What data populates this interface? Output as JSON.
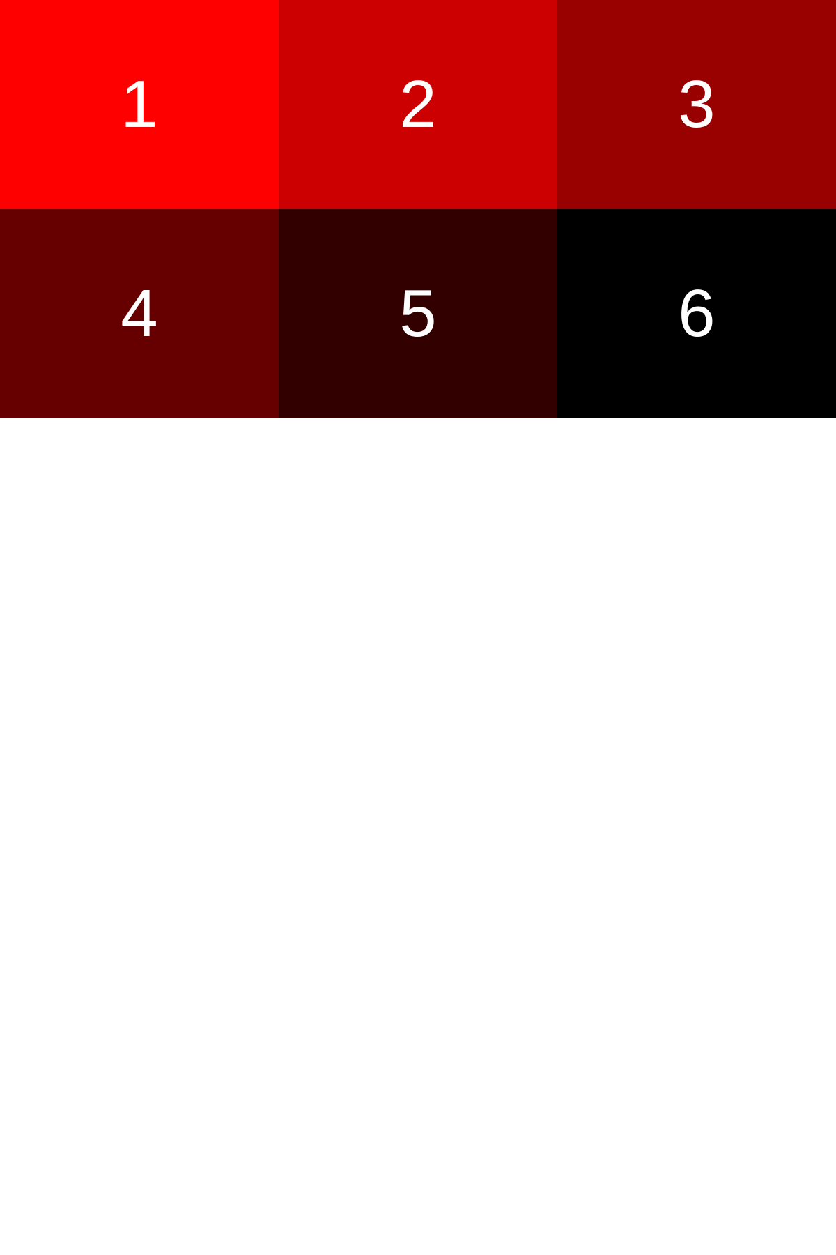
{
  "tiles": [
    {
      "label": "1",
      "color": "#ff0000"
    },
    {
      "label": "2",
      "color": "#cc0000"
    },
    {
      "label": "3",
      "color": "#990000"
    },
    {
      "label": "4",
      "color": "#660000"
    },
    {
      "label": "5",
      "color": "#330000"
    },
    {
      "label": "6",
      "color": "#000000"
    }
  ],
  "background_color": "#ffffff"
}
